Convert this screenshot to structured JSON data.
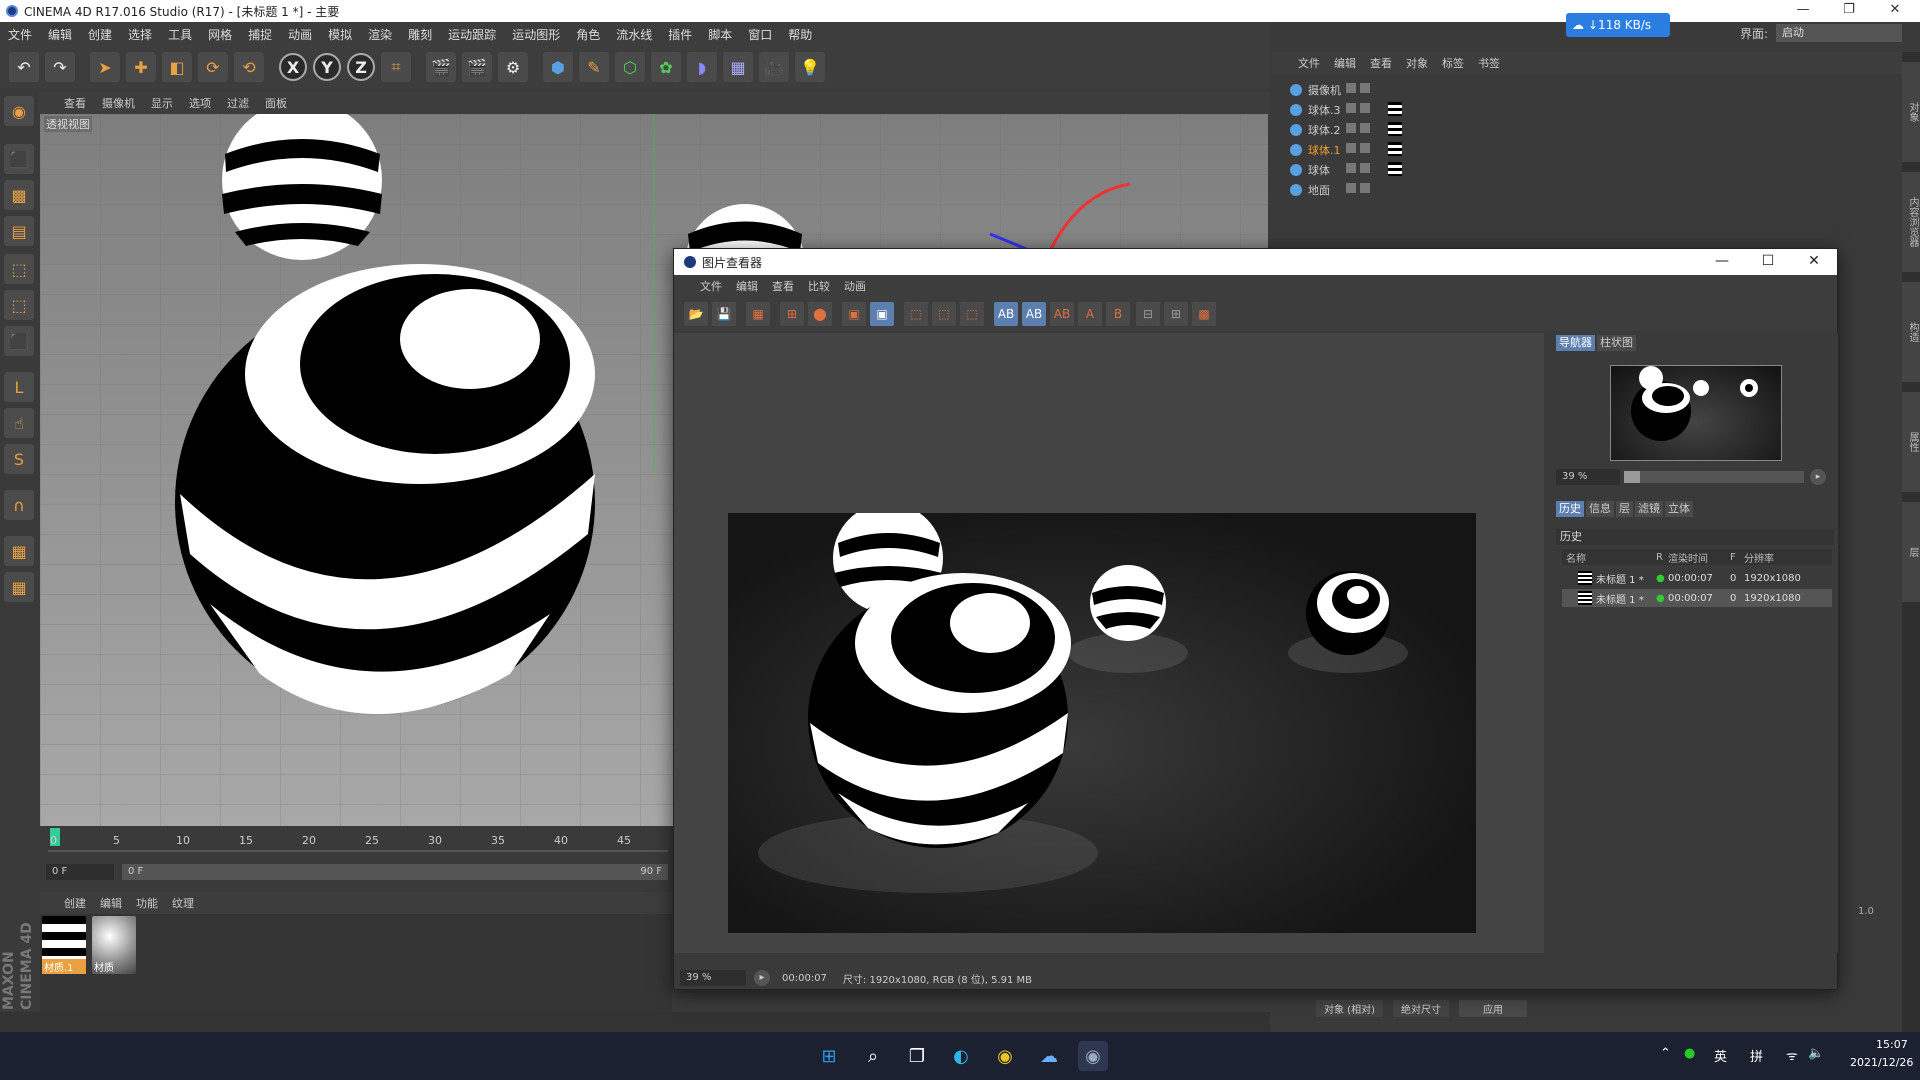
{
  "window": {
    "title": "CINEMA 4D R17.016 Studio (R17) - [未标题 1 *] - 主要"
  },
  "menubar": [
    "文件",
    "编辑",
    "创建",
    "选择",
    "工具",
    "网格",
    "捕捉",
    "动画",
    "模拟",
    "渲染",
    "雕刻",
    "运动跟踪",
    "运动图形",
    "角色",
    "流水线",
    "插件",
    "脚本",
    "窗口",
    "帮助"
  ],
  "net_badge": "↓118 KB/s",
  "layout": {
    "label": "界面:",
    "value": "启动"
  },
  "viewport": {
    "menu": [
      "查看",
      "摄像机",
      "显示",
      "选项",
      "过滤",
      "面板"
    ],
    "label": "透视视图"
  },
  "timeline": {
    "ticks": [
      "0",
      "5",
      "10",
      "15",
      "20",
      "25",
      "30",
      "35",
      "40",
      "45"
    ],
    "current_frame": "0 F",
    "range_start": "0 F",
    "range_end": "90 F"
  },
  "material_menu": [
    "创建",
    "编辑",
    "功能",
    "纹理"
  ],
  "materials": [
    {
      "label": "材质.1"
    },
    {
      "label": "材质"
    }
  ],
  "brand": "MAXON CINEMA 4D",
  "object_manager": {
    "menu": [
      "文件",
      "编辑",
      "查看",
      "对象",
      "标签",
      "书签"
    ],
    "objects": [
      {
        "name": "摄像机"
      },
      {
        "name": "球体.3"
      },
      {
        "name": "球体.2"
      },
      {
        "name": "球体.1",
        "active": true
      },
      {
        "name": "球体"
      },
      {
        "name": "地面"
      }
    ]
  },
  "side_tabs": [
    "对象",
    "内容浏览器",
    "构造",
    "属性",
    "层"
  ],
  "attr_bar": {
    "mode": "对象 (相对)",
    "size": "绝对尺寸",
    "apply": "应用"
  },
  "picture_viewer": {
    "title": "图片查看器",
    "menu": [
      "文件",
      "编辑",
      "查看",
      "比较",
      "动画"
    ],
    "tabs_top": [
      "导航器",
      "柱状图"
    ],
    "zoom": "39 %",
    "zoom_fraction": 0.09,
    "tabs_mid": [
      "历史",
      "信息",
      "层",
      "滤镜",
      "立体"
    ],
    "history_label": "历史",
    "history_headers": [
      "名称",
      "R",
      "渲染时间",
      "F",
      "分辨率"
    ],
    "history_rows": [
      {
        "name": "未标题 1 *",
        "time": "00:00:07",
        "frame": "0",
        "res": "1920x1080"
      },
      {
        "name": "未标题 1 *",
        "time": "00:00:07",
        "frame": "0",
        "res": "1920x1080"
      }
    ],
    "status_zoom": "39 %",
    "status_time": "00:00:07",
    "status_info": "尺寸: 1920x1080, RGB (8 位), 5.91 MB"
  },
  "side_value": "1.0",
  "taskbar": {
    "tray_lang": "英",
    "tray_ime": "拼",
    "time": "15:07",
    "date": "2021/12/26"
  }
}
